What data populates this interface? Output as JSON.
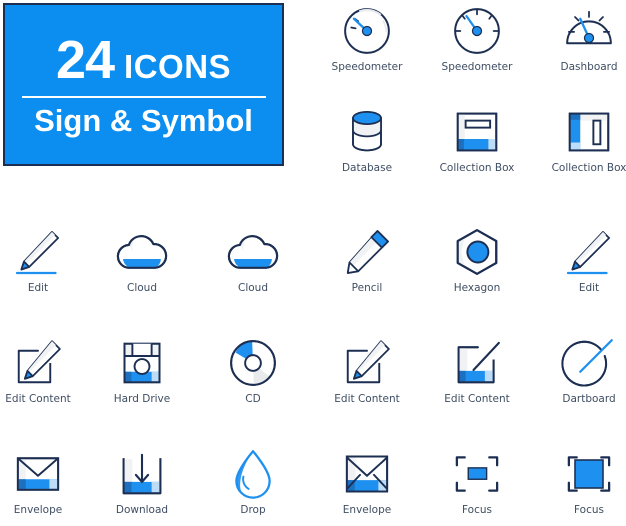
{
  "title_card": {
    "count": "24",
    "word": "ICONS",
    "subtitle": "Sign & Symbol",
    "background_color": "#0b8ef0",
    "border_color": "#1c2f52",
    "text_color": "#ffffff"
  },
  "palette": {
    "blue": "#1e90f0",
    "blue_dark": "#1d6fc0",
    "blue_light": "#bddcf7",
    "outline": "#1c2f52",
    "gray_fill": "#e8eaec",
    "gray_light": "#f1f2f4",
    "label": "#3f4e63",
    "white": "#ffffff"
  },
  "grid": {
    "columns": 6,
    "rows": 5,
    "total_icons": 24
  },
  "icons": [
    {
      "id": "speedometer-1",
      "label": "Speedometer",
      "glyph": "speedometer-round",
      "row": 1,
      "col": 4
    },
    {
      "id": "speedometer-2",
      "label": "Speedometer",
      "glyph": "speedometer-ticks",
      "row": 1,
      "col": 5
    },
    {
      "id": "dashboard",
      "label": "Dashboard",
      "glyph": "dashboard-dome",
      "row": 1,
      "col": 6
    },
    {
      "id": "database",
      "label": "Database",
      "glyph": "database-cylinder",
      "row": 2,
      "col": 4
    },
    {
      "id": "collection-box-1",
      "label": "Collection Box",
      "glyph": "collection-box-slot",
      "row": 2,
      "col": 5
    },
    {
      "id": "collection-box-2",
      "label": "Collection Box",
      "glyph": "collection-box-side",
      "row": 2,
      "col": 6
    },
    {
      "id": "edit-1",
      "label": "Edit",
      "glyph": "pencil-underline",
      "row": 3,
      "col": 1
    },
    {
      "id": "cloud-1",
      "label": "Cloud",
      "glyph": "cloud-filled",
      "row": 3,
      "col": 2
    },
    {
      "id": "cloud-2",
      "label": "Cloud",
      "glyph": "cloud-filled",
      "row": 3,
      "col": 3
    },
    {
      "id": "pencil",
      "label": "Pencil",
      "glyph": "pencil-eraser",
      "row": 3,
      "col": 4
    },
    {
      "id": "hexagon",
      "label": "Hexagon",
      "glyph": "hexagon-circle",
      "row": 3,
      "col": 5
    },
    {
      "id": "edit-2",
      "label": "Edit",
      "glyph": "pencil-underline",
      "row": 3,
      "col": 6
    },
    {
      "id": "edit-content-1",
      "label": "Edit Content",
      "glyph": "square-pencil",
      "row": 4,
      "col": 1
    },
    {
      "id": "hard-drive",
      "label": "Hard Drive",
      "glyph": "floppy-disk",
      "row": 4,
      "col": 2
    },
    {
      "id": "cd",
      "label": "CD",
      "glyph": "cd-disc",
      "row": 4,
      "col": 3
    },
    {
      "id": "edit-content-2",
      "label": "Edit Content",
      "glyph": "square-pencil",
      "row": 4,
      "col": 4
    },
    {
      "id": "edit-content-3",
      "label": "Edit Content",
      "glyph": "square-stroke",
      "row": 4,
      "col": 5
    },
    {
      "id": "dartboard",
      "label": "Dartboard",
      "glyph": "dartboard-arrow",
      "row": 4,
      "col": 6
    },
    {
      "id": "envelope-1",
      "label": "Envelope",
      "glyph": "envelope-flap",
      "row": 5,
      "col": 1
    },
    {
      "id": "download",
      "label": "Download",
      "glyph": "download-box",
      "row": 5,
      "col": 2
    },
    {
      "id": "drop",
      "label": "Drop",
      "glyph": "water-drop",
      "row": 5,
      "col": 3
    },
    {
      "id": "envelope-2",
      "label": "Envelope",
      "glyph": "envelope-cross",
      "row": 5,
      "col": 4
    },
    {
      "id": "focus-1",
      "label": "Focus",
      "glyph": "focus-small",
      "row": 5,
      "col": 5
    },
    {
      "id": "focus-2",
      "label": "Focus",
      "glyph": "focus-large",
      "row": 5,
      "col": 6
    }
  ]
}
